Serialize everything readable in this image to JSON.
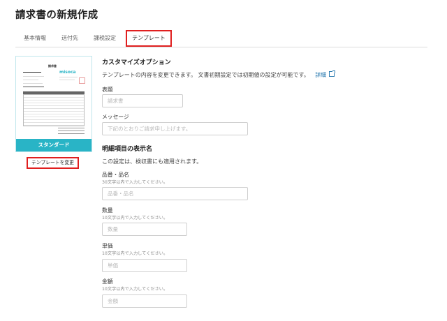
{
  "page": {
    "title": "請求書の新規作成"
  },
  "tabs": [
    {
      "label": "基本情報"
    },
    {
      "label": "送付先"
    },
    {
      "label": "課税設定"
    },
    {
      "label": "テンプレート",
      "active": true
    }
  ],
  "template_preview": {
    "doc_title": "請求書",
    "logo_text": "misoca",
    "band_label": "スタンダード",
    "change_button": "テンプレートを変更"
  },
  "customize": {
    "heading": "カスタマイズオプション",
    "description": "テンプレートの内容を変更できます。 文書初期設定では初期値の設定が可能です。",
    "detail_link": "詳細",
    "title_field": {
      "label": "表題",
      "placeholder": "請求書"
    },
    "message_field": {
      "label": "メッセージ",
      "placeholder": "下記のとおりご請求申し上げます。"
    }
  },
  "item_names": {
    "heading": "明細項目の表示名",
    "note": "この設定は、検収書にも適用されます。",
    "fields": [
      {
        "label": "品番・品名",
        "hint": "30文字以内で入力してください。",
        "placeholder": "品番・品名"
      },
      {
        "label": "数量",
        "hint": "10文字以内で入力してください。",
        "placeholder": "数量"
      },
      {
        "label": "単価",
        "hint": "10文字以内で入力してください。",
        "placeholder": "単価"
      },
      {
        "label": "金額",
        "hint": "10文字以内で入力してください。",
        "placeholder": "金額"
      }
    ]
  },
  "colors": {
    "accent": "#29b4c6",
    "highlight": "#e01f1f",
    "link": "#2a7ab0"
  }
}
